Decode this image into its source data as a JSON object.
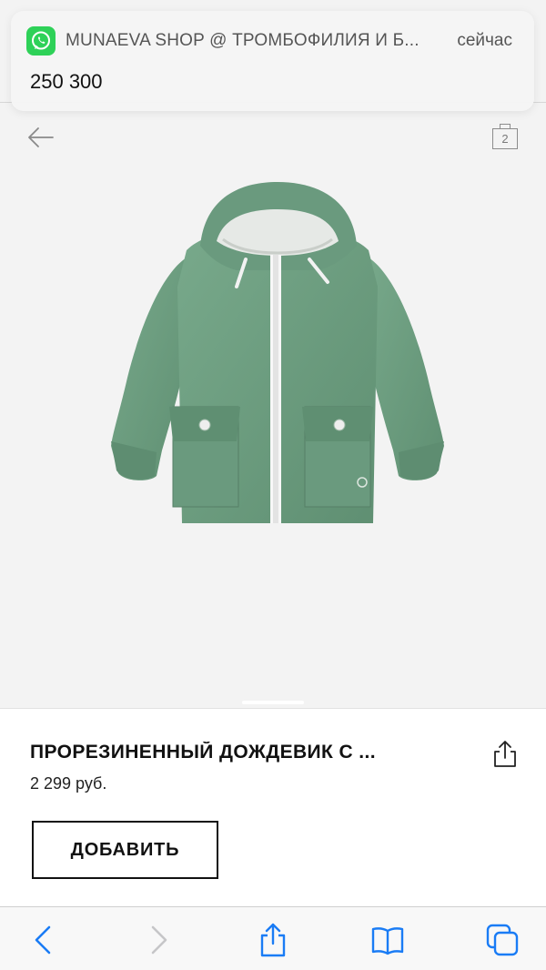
{
  "notification": {
    "app_icon": "whatsapp-icon",
    "title": "MUNAEVA SHOP @ ТРОМБОФИЛИЯ И Б...",
    "time": "сейчас",
    "body": "250 300"
  },
  "gallery": {
    "count": "2",
    "back_icon": "arrow-left-icon",
    "product_color": "#6e9d80"
  },
  "product": {
    "title": "ПРОРЕЗИНЕННЫЙ ДОЖДЕВИК С ...",
    "price": "2 299 руб.",
    "add_label": "ДОБАВИТЬ",
    "share_icon": "share-icon"
  },
  "toolbar": {
    "accent": "#1a7cf5",
    "items": [
      "back-icon",
      "forward-icon",
      "share-icon",
      "bookmarks-icon",
      "tabs-icon"
    ]
  }
}
